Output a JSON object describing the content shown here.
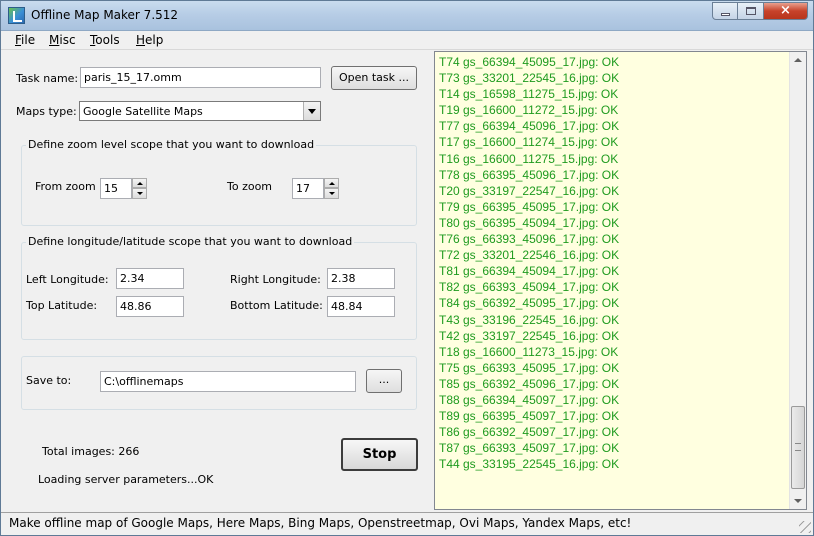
{
  "window": {
    "title": "Offline Map Maker 7.512",
    "buttons": {
      "minimize_icon": "minimize-icon",
      "maximize_icon": "maximize-icon",
      "close_icon": "close-icon",
      "close_glyph": "×"
    }
  },
  "menu": {
    "file": "File",
    "misc": "Misc",
    "tools": "Tools",
    "help": "Help"
  },
  "task": {
    "name_label": "Task name:",
    "name_value": "paris_15_17.omm",
    "open_button": "Open task ..."
  },
  "maps_type": {
    "label": "Maps type:",
    "selected": "Google Satellite Maps"
  },
  "zoom": {
    "group_title": "Define zoom level scope that you want to download",
    "from_label": "From zoom",
    "from_value": "15",
    "to_label": "To zoom",
    "to_value": "17"
  },
  "coords": {
    "group_title": "Define longitude/latitude scope that you want to download",
    "left_lon_label": "Left Longitude:",
    "left_lon_value": "2.34",
    "right_lon_label": "Right Longitude:",
    "right_lon_value": "2.38",
    "top_lat_label": "Top Latitude:",
    "top_lat_value": "48.86",
    "bottom_lat_label": "Bottom Latitude:",
    "bottom_lat_value": "48.84"
  },
  "save": {
    "label": "Save to:",
    "path": "C:\\offlinemaps",
    "browse_button": "..."
  },
  "progress": {
    "total_images": "Total images: 266",
    "stop_button": "Stop",
    "loading_message": "Loading server parameters...OK"
  },
  "log": {
    "lines": [
      "T74 gs_66394_45095_17.jpg: OK",
      "T73 gs_33201_22545_16.jpg: OK",
      "T14 gs_16598_11275_15.jpg: OK",
      "T19 gs_16600_11272_15.jpg: OK",
      "T77 gs_66394_45096_17.jpg: OK",
      "T17 gs_16600_11274_15.jpg: OK",
      "T16 gs_16600_11275_15.jpg: OK",
      "T78 gs_66395_45096_17.jpg: OK",
      "T20 gs_33197_22547_16.jpg: OK",
      "T79 gs_66395_45095_17.jpg: OK",
      "T80 gs_66395_45094_17.jpg: OK",
      "T76 gs_66393_45096_17.jpg: OK",
      "T72 gs_33201_22546_16.jpg: OK",
      "T81 gs_66394_45094_17.jpg: OK",
      "T82 gs_66393_45094_17.jpg: OK",
      "T84 gs_66392_45095_17.jpg: OK",
      "T43 gs_33196_22545_16.jpg: OK",
      "T42 gs_33197_22545_16.jpg: OK",
      "T18 gs_16600_11273_15.jpg: OK",
      "T75 gs_66393_45095_17.jpg: OK",
      "T85 gs_66392_45096_17.jpg: OK",
      "T88 gs_66394_45097_17.jpg: OK",
      "T89 gs_66395_45097_17.jpg: OK",
      "T86 gs_66392_45097_17.jpg: OK",
      "T87 gs_66393_45097_17.jpg: OK",
      "T44 gs_33195_22545_16.jpg: OK"
    ],
    "text_color": "#1f9b1f",
    "background": "#ffffe0"
  },
  "statusbar": {
    "text": "Make offline map of Google Maps, Here Maps, Bing Maps, Openstreetmap, Ovi Maps, Yandex Maps,  etc!"
  }
}
